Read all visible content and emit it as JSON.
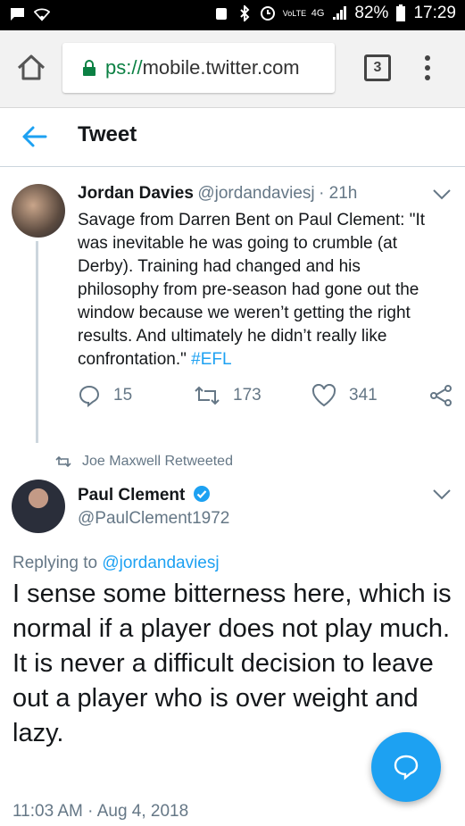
{
  "statusbar": {
    "battery": "82%",
    "time": "17:29",
    "network": "4G",
    "volte": "VoLTE"
  },
  "browser": {
    "url_scheme": "ps://",
    "url_host": "mobile.twitter.com",
    "tab_count": "3"
  },
  "header": {
    "title": "Tweet"
  },
  "parent_tweet": {
    "name": "Jordan Davies",
    "handle": "@jordandaviesj",
    "age": "· 21h",
    "text": "Savage from Darren Bent on Paul Clement: \"It was inevitable he was going to crumble (at Derby). Training had changed and his philosophy from pre-season had gone out the window because we weren’t getting the right results. And ultimately he didn’t really like confrontation.\" ",
    "hashtag": "#EFL",
    "replies": "15",
    "retweets": "173",
    "likes": "341"
  },
  "retweet_banner": "Joe Maxwell Retweeted",
  "main_tweet": {
    "name": "Paul Clement",
    "handle": "@PaulClement1972",
    "replying_prefix": "Replying to ",
    "replying_to": "@jordandaviesj",
    "text_1": "I sense some bitterness here, which is normal if a player does not play much.",
    "text_2": "It is never a difficult decision to leave out a player who is over weight and lazy.",
    "timestamp": "11:03 AM · Aug 4, 2018"
  },
  "colors": {
    "accent": "#1da1f2",
    "muted": "#657786",
    "verified": "#1da1f2"
  }
}
